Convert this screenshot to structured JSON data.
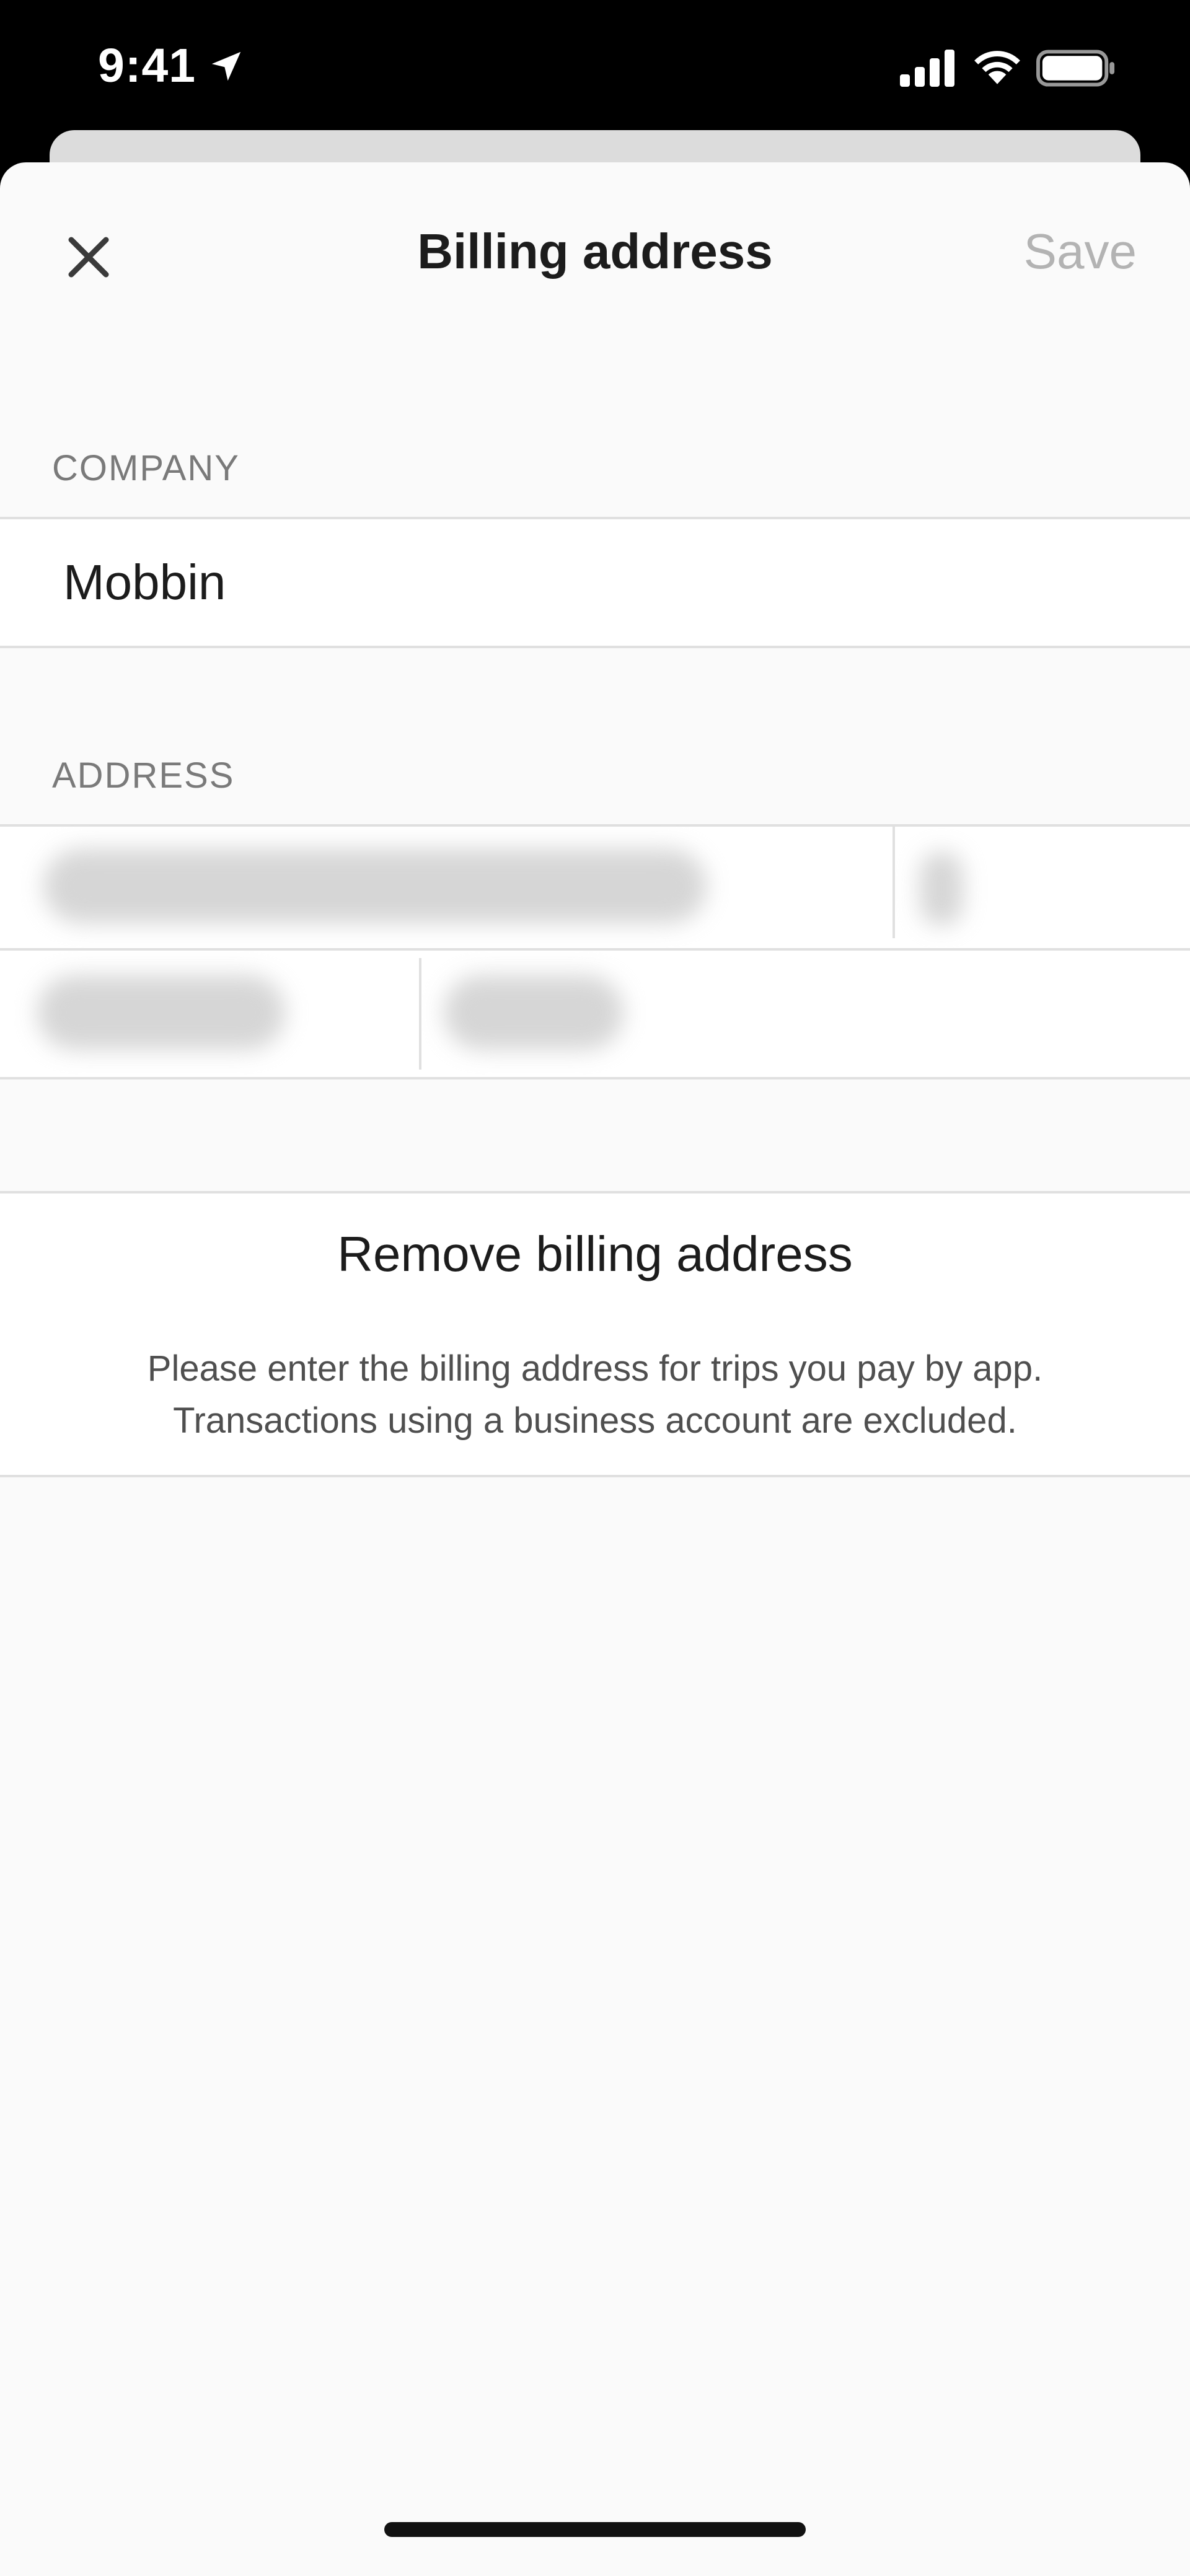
{
  "status_bar": {
    "time": "9:41"
  },
  "header": {
    "title": "Billing address",
    "save_label": "Save"
  },
  "company": {
    "section_label": "COMPANY",
    "value": "Mobbin"
  },
  "address": {
    "section_label": "ADDRESS"
  },
  "actions": {
    "remove_label": "Remove billing address"
  },
  "note": {
    "line1": "Please enter the billing address for trips you pay by app.",
    "line2": "Transactions using a business account are excluded."
  },
  "colors": {
    "sheet_background": "#fafafa",
    "row_background": "#ffffff",
    "disabled_text": "#b3b3b3",
    "primary_text": "#1c1c1c",
    "secondary_text": "#7a7a7a",
    "separator": "#e0e0e0"
  },
  "icons": {
    "close": "close-icon",
    "location": "location-arrow-icon",
    "signal": "cellular-signal-icon",
    "wifi": "wifi-icon",
    "battery": "battery-icon"
  }
}
